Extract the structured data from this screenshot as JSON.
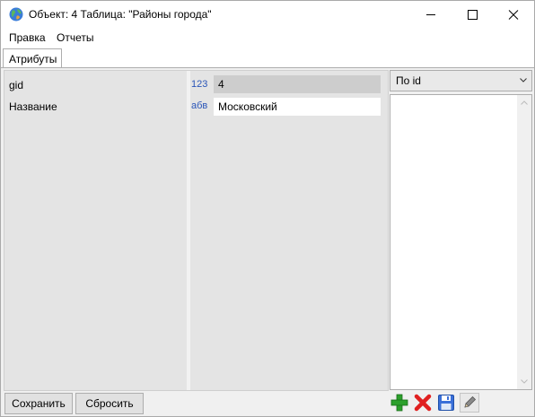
{
  "window": {
    "title": "Объект: 4 Таблица: \"Районы города\""
  },
  "menu": {
    "items": [
      "Правка",
      "Отчеты"
    ]
  },
  "tabs": [
    {
      "label": "Атрибуты"
    }
  ],
  "attributes": [
    {
      "name": "gid",
      "type": "123",
      "value": "4"
    },
    {
      "name": "Название",
      "type": "абв",
      "value": "Московский"
    }
  ],
  "sort_select": {
    "value": "По id"
  },
  "buttons": {
    "save": "Сохранить",
    "reset": "Сбросить"
  },
  "icons": {
    "app": "globe-icon",
    "add": "plus-icon",
    "delete": "x-icon",
    "save": "floppy-icon",
    "edit": "pencil-icon"
  },
  "colors": {
    "type_tag": "#2a55b8",
    "add_green": "#2ca02c",
    "delete_red": "#e02020",
    "save_blue": "#3a6fd8"
  }
}
